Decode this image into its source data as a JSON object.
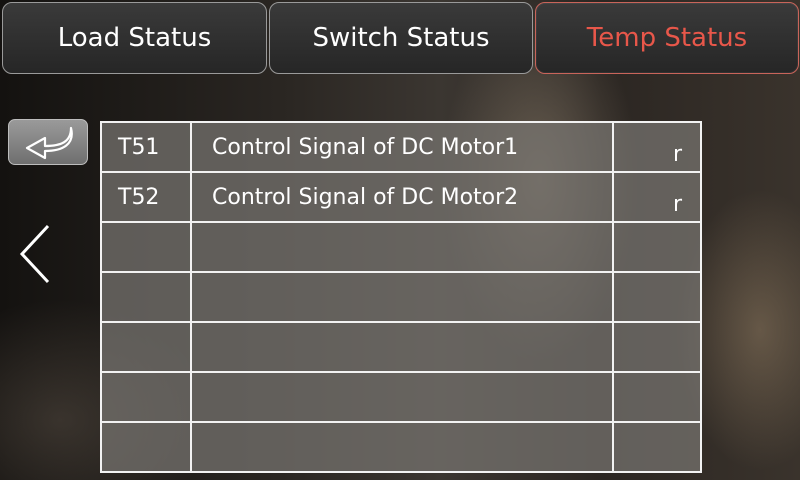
{
  "tabs": [
    {
      "label": "Load Status",
      "active": false
    },
    {
      "label": "Switch Status",
      "active": false
    },
    {
      "label": "Temp Status",
      "active": true
    }
  ],
  "colors": {
    "active_tab_text": "#e8574a",
    "active_tab_border": "#c9645a",
    "grid_line": "#f2f2f2"
  },
  "icons": {
    "back": "return-arrow-icon",
    "previous": "chevron-left-icon"
  },
  "table": {
    "rows": [
      {
        "id": "T51",
        "desc": "Control Signal of DC Motor1",
        "val": "r"
      },
      {
        "id": "T52",
        "desc": "Control Signal of DC Motor2",
        "val": "r"
      },
      {
        "id": "",
        "desc": "",
        "val": ""
      },
      {
        "id": "",
        "desc": "",
        "val": ""
      },
      {
        "id": "",
        "desc": "",
        "val": ""
      },
      {
        "id": "",
        "desc": "",
        "val": ""
      },
      {
        "id": "",
        "desc": "",
        "val": ""
      }
    ]
  }
}
